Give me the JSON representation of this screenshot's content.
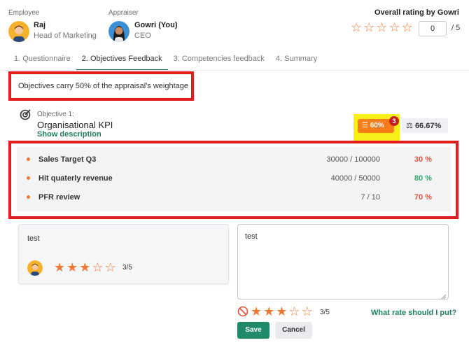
{
  "header": {
    "employee": {
      "role_label": "Employee",
      "name": "Raj",
      "title": "Head of Marketing",
      "avatar_icon": "male-avatar-icon"
    },
    "appraiser": {
      "role_label": "Appraiser",
      "name": "Gowri (You)",
      "title": "CEO",
      "avatar_icon": "female-avatar-icon"
    },
    "overall": {
      "label": "Overall rating by Gowri",
      "stars_filled": 0,
      "stars_total": 5,
      "input_value": "0",
      "total_text": "/ 5"
    }
  },
  "tabs": [
    {
      "label": "1. Questionnaire",
      "active": false
    },
    {
      "label": "2. Objectives Feedback",
      "active": true
    },
    {
      "label": "3. Competencies feedback",
      "active": false
    },
    {
      "label": "4. Summary",
      "active": false
    }
  ],
  "weightage_text": "Objectives carry 50% of the appraisal's weightage",
  "objective": {
    "label": "Objective 1:",
    "title": "Organisational KPI",
    "show_description": "Show description",
    "progress_badge": "60%",
    "progress_count": "3",
    "weight_badge": "66.67%",
    "kpis": [
      {
        "name": "Sales Target Q3",
        "value": "30000 / 100000",
        "percent": "30 %",
        "status_color": "#e5533d"
      },
      {
        "name": "Hit quaterly revenue",
        "value": "40000 / 50000",
        "percent": "80 %",
        "status_color": "#2eaa6b"
      },
      {
        "name": "PFR review",
        "value": "7 / 10",
        "percent": "70 %",
        "status_color": "#e5533d"
      }
    ]
  },
  "employee_feedback": {
    "text": "test",
    "rating": 3,
    "stars_total": 5,
    "rating_text": "3/5"
  },
  "appraiser_feedback": {
    "text": "test",
    "rating": 3,
    "stars_total": 5,
    "rating_text": "3/5",
    "help_link": "What rate should I put?"
  },
  "actions": {
    "save": "Save",
    "cancel": "Cancel"
  },
  "colors": {
    "accent": "#1e8a6a",
    "star": "#f07a35",
    "highlight_red": "#e21b1b"
  }
}
